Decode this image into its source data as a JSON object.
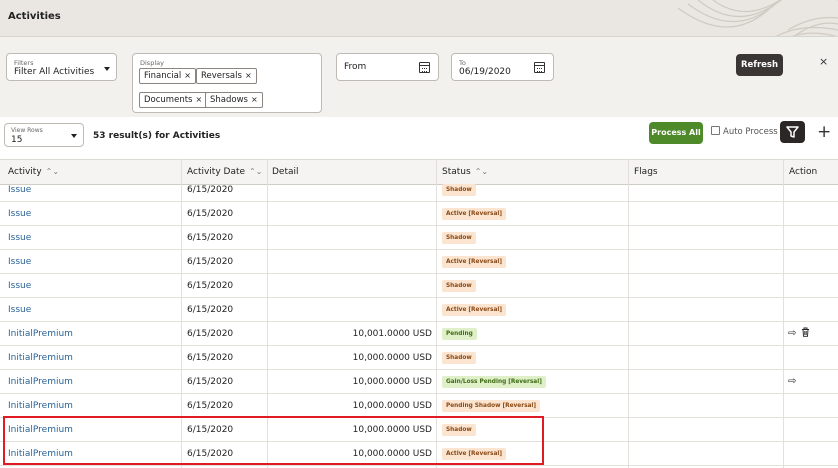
{
  "header": {
    "title": "Activities"
  },
  "filters": {
    "filters_label": "Filters",
    "filters_value": "Filter All Activities",
    "display_label": "Display",
    "display_chips": [
      "Financial",
      "Reversals",
      "Documents",
      "Shadows"
    ],
    "from_label": "From",
    "to_label": "To",
    "to_value": "06/19/2020",
    "refresh_label": "Refresh",
    "close_glyph": "×"
  },
  "toolbar": {
    "rows_label": "View Rows",
    "rows_value": "15",
    "result_text": "53 result(s) for Activities",
    "process_all_label": "Process All",
    "auto_process_label": "Auto Process",
    "plus_glyph": "+"
  },
  "table": {
    "columns": [
      "Activity",
      "Activity Date",
      "Detail",
      "Status",
      "Flags",
      "Action"
    ],
    "sort_glyph": "⌃⌄",
    "rows": [
      {
        "activity": "Issue",
        "date": "6/15/2020",
        "detail": "",
        "status": "Shadow",
        "status_color": "orange",
        "actions": ""
      },
      {
        "activity": "Issue",
        "date": "6/15/2020",
        "detail": "",
        "status": "Active [Reversal]",
        "status_color": "orange",
        "actions": ""
      },
      {
        "activity": "Issue",
        "date": "6/15/2020",
        "detail": "",
        "status": "Shadow",
        "status_color": "orange",
        "actions": ""
      },
      {
        "activity": "Issue",
        "date": "6/15/2020",
        "detail": "",
        "status": "Active [Reversal]",
        "status_color": "orange",
        "actions": ""
      },
      {
        "activity": "Issue",
        "date": "6/15/2020",
        "detail": "",
        "status": "Shadow",
        "status_color": "orange",
        "actions": ""
      },
      {
        "activity": "Issue",
        "date": "6/15/2020",
        "detail": "",
        "status": "Active [Reversal]",
        "status_color": "orange",
        "actions": ""
      },
      {
        "activity": "InitialPremium",
        "date": "6/15/2020",
        "detail": "10,001.0000 USD",
        "status": "Pending",
        "status_color": "green",
        "actions": "arrow-trash"
      },
      {
        "activity": "InitialPremium",
        "date": "6/15/2020",
        "detail": "10,000.0000 USD",
        "status": "Shadow",
        "status_color": "orange",
        "actions": ""
      },
      {
        "activity": "InitialPremium",
        "date": "6/15/2020",
        "detail": "10,000.0000 USD",
        "status": "Gain/Loss Pending [Reversal]",
        "status_color": "green",
        "actions": "arrow"
      },
      {
        "activity": "InitialPremium",
        "date": "6/15/2020",
        "detail": "10,000.0000 USD",
        "status": "Pending Shadow [Reversal]",
        "status_color": "orange",
        "actions": ""
      },
      {
        "activity": "InitialPremium",
        "date": "6/15/2020",
        "detail": "10,000.0000 USD",
        "status": "Shadow",
        "status_color": "orange",
        "actions": ""
      },
      {
        "activity": "InitialPremium",
        "date": "6/15/2020",
        "detail": "10,000.0000 USD",
        "status": "Active [Reversal]",
        "status_color": "orange",
        "actions": ""
      }
    ]
  },
  "colors": {
    "link": "#2a6496",
    "process_all_bg": "#4e8a2a",
    "highlight_border": "#e01b24",
    "badge_orange_bg": "#fbe4d0",
    "badge_green_bg": "#dff0c9"
  }
}
